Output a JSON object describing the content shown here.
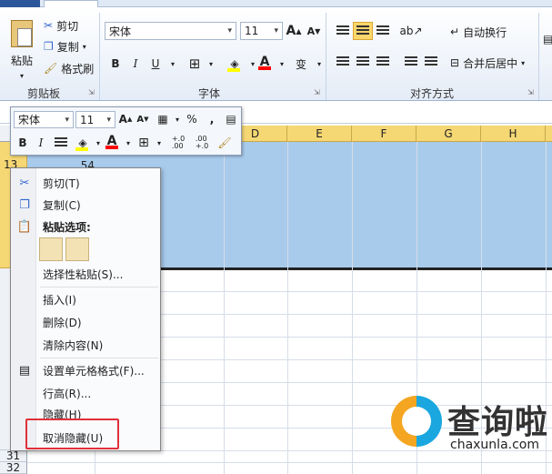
{
  "ribbon": {
    "clipboard": {
      "paste": "粘贴",
      "cut": "剪切",
      "copy": "复制",
      "format_painter": "格式刷",
      "group_label": "剪贴板"
    },
    "font": {
      "font_name": "宋体",
      "font_size": "11",
      "bold": "B",
      "italic": "I",
      "underline": "U",
      "grow": "A",
      "shrink": "A",
      "wen": "变",
      "group_label": "字体"
    },
    "alignment": {
      "wrap_text": "自动换行",
      "merge_center": "合并后居中",
      "group_label": "对齐方式"
    }
  },
  "mini_toolbar": {
    "font_name": "宋体",
    "font_size": "11",
    "bold": "B",
    "italic": "I",
    "percent": "%",
    "comma": ",",
    "dec_increase": "+.0\n.00",
    "dec_decrease": ".00\n+.0"
  },
  "grid": {
    "columns": [
      "D",
      "E",
      "F",
      "G",
      "H"
    ],
    "rows": [
      {
        "label": "13",
        "value": "54"
      },
      {
        "label": "31",
        "value": ""
      },
      {
        "label": "32",
        "value": ""
      }
    ]
  },
  "context_menu": {
    "items": [
      {
        "label": "剪切(T)",
        "icon": "scissors-icon"
      },
      {
        "label": "复制(C)",
        "icon": "copy-icon"
      },
      {
        "label": "粘贴选项:",
        "icon": "paste-icon"
      },
      {
        "label": "选择性粘贴(S)...",
        "icon": ""
      },
      {
        "label": "插入(I)",
        "icon": ""
      },
      {
        "label": "删除(D)",
        "icon": ""
      },
      {
        "label": "清除内容(N)",
        "icon": ""
      },
      {
        "label": "设置单元格格式(F)...",
        "icon": "format-cells-icon"
      },
      {
        "label": "行高(R)...",
        "icon": ""
      },
      {
        "label": "隐藏(H)",
        "icon": ""
      },
      {
        "label": "取消隐藏(U)",
        "icon": ""
      }
    ]
  },
  "watermark": {
    "title": "查询啦",
    "subtitle": "chaxunla.com"
  },
  "colors": {
    "selection": "#a8cbec",
    "header_highlight": "#f5d774",
    "highlight_box": "#e0303a"
  }
}
